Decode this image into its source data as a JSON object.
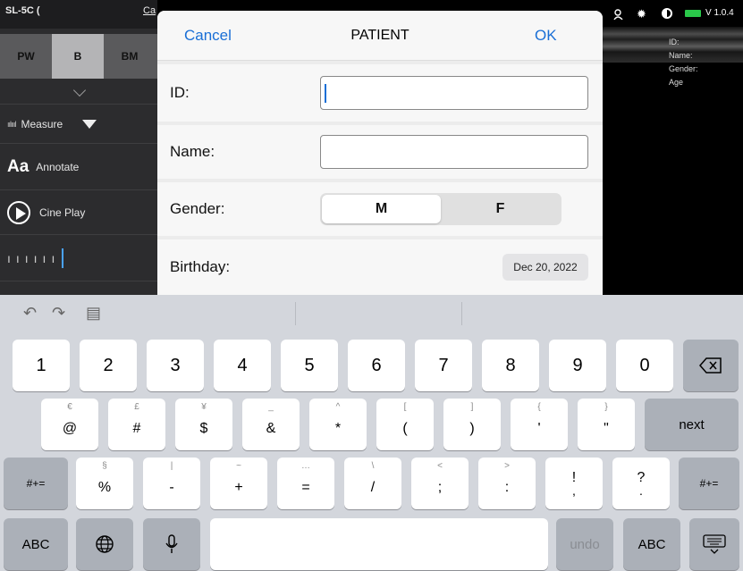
{
  "sidebar": {
    "probe": "SL-5C (",
    "ca": "Ca",
    "modes": [
      "PW",
      "B",
      "BM"
    ],
    "active_mode": "B",
    "measure": "Measure",
    "annotate_icon": "Aa",
    "annotate": "Annotate",
    "cine_play": "Cine Play"
  },
  "status": {
    "version": "V 1.0.4",
    "icons": [
      "person-icon",
      "gear-icon",
      "contrast-icon",
      "battery-icon"
    ]
  },
  "patient_overlay": {
    "id": "ID:",
    "name": "Name:",
    "gender": "Gender:",
    "age": "Age"
  },
  "dialog": {
    "cancel": "Cancel",
    "title": "PATIENT",
    "ok": "OK",
    "id_label": "ID:",
    "id_value": "",
    "name_label": "Name:",
    "name_value": "",
    "gender_label": "Gender:",
    "gender_options": [
      "M",
      "F"
    ],
    "gender_selected": "M",
    "birthday_label": "Birthday:",
    "birthday_value": "Dec 20, 2022"
  },
  "keyboard": {
    "toolbar": [
      "undo-icon",
      "redo-icon",
      "paste-icon"
    ],
    "row1": [
      "1",
      "2",
      "3",
      "4",
      "5",
      "6",
      "7",
      "8",
      "9",
      "0"
    ],
    "row2": [
      {
        "alt": "€",
        "main": "@"
      },
      {
        "alt": "£",
        "main": "#"
      },
      {
        "alt": "¥",
        "main": "$"
      },
      {
        "alt": "_",
        "main": "&"
      },
      {
        "alt": "^",
        "main": "*"
      },
      {
        "alt": "[",
        "main": "("
      },
      {
        "alt": "]",
        "main": ")"
      },
      {
        "alt": "{",
        "main": "'"
      },
      {
        "alt": "}",
        "main": "\""
      }
    ],
    "next": "next",
    "sym_key": "#+=",
    "row3": [
      {
        "alt": "§",
        "main": "%"
      },
      {
        "alt": "|",
        "main": "-"
      },
      {
        "alt": "~",
        "main": "+"
      },
      {
        "alt": "…",
        "main": "="
      },
      {
        "alt": "\\",
        "main": "/"
      },
      {
        "alt": "<",
        "main": ";"
      },
      {
        "alt": ">",
        "main": ":"
      },
      {
        "alt": "",
        "main": "!"
      },
      {
        "alt": "",
        "main": "?"
      }
    ],
    "row3_sub": [
      ",",
      "."
    ],
    "abc": "ABC",
    "undo": "undo",
    "icons": {
      "globe": "globe-icon",
      "mic": "microphone-icon",
      "dismiss": "keyboard-dismiss-icon",
      "backspace": "backspace-icon"
    }
  },
  "colors": {
    "accent": "#1a6fd6",
    "battery": "#2ac84a"
  }
}
